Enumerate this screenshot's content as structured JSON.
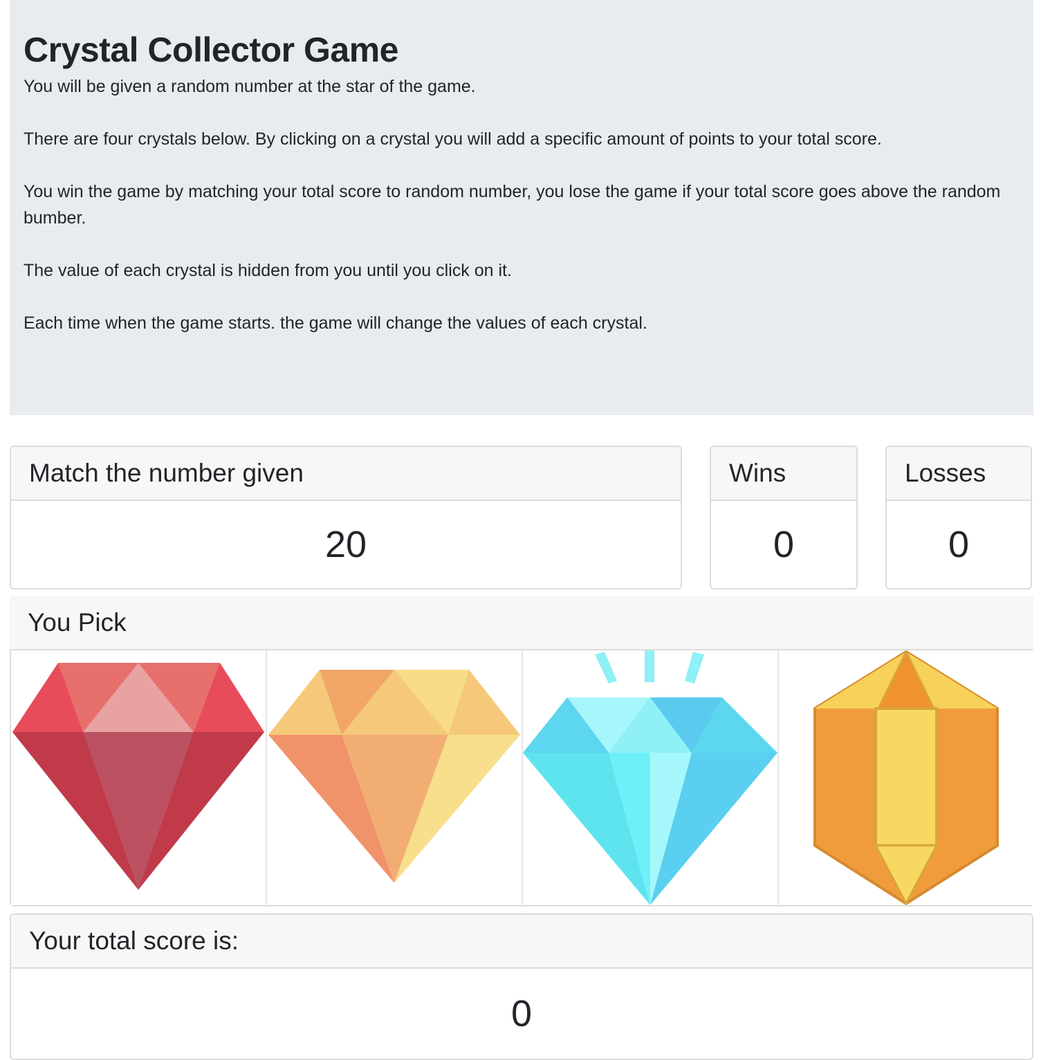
{
  "intro": {
    "title": "Crystal Collector Game",
    "paragraphs": [
      "You will be given a random number at the star of the game.",
      "There are four crystals below. By clicking on a crystal you will add a specific amount of points to your total score.",
      "You win the game by matching your total score to random number, you lose the game if your total score goes above the random bumber.",
      "The value of each crystal is hidden from you until you click on it.",
      "Each time when the game starts. the game will change the values of each crystal."
    ]
  },
  "target": {
    "label": "Match the number given",
    "value": "20"
  },
  "wins": {
    "label": "Wins",
    "value": "0"
  },
  "losses": {
    "label": "Losses",
    "value": "0"
  },
  "pick": {
    "label": "You Pick",
    "crystals": [
      {
        "icon": "red-gem-icon",
        "color": "#e84c5a"
      },
      {
        "icon": "orange-gem-icon",
        "color": "#f3a768"
      },
      {
        "icon": "blue-diamond-icon",
        "color": "#5ce1ef"
      },
      {
        "icon": "amber-crystal-icon",
        "color": "#f19c3c"
      }
    ]
  },
  "score": {
    "label": "Your total score is:",
    "value": "0"
  }
}
